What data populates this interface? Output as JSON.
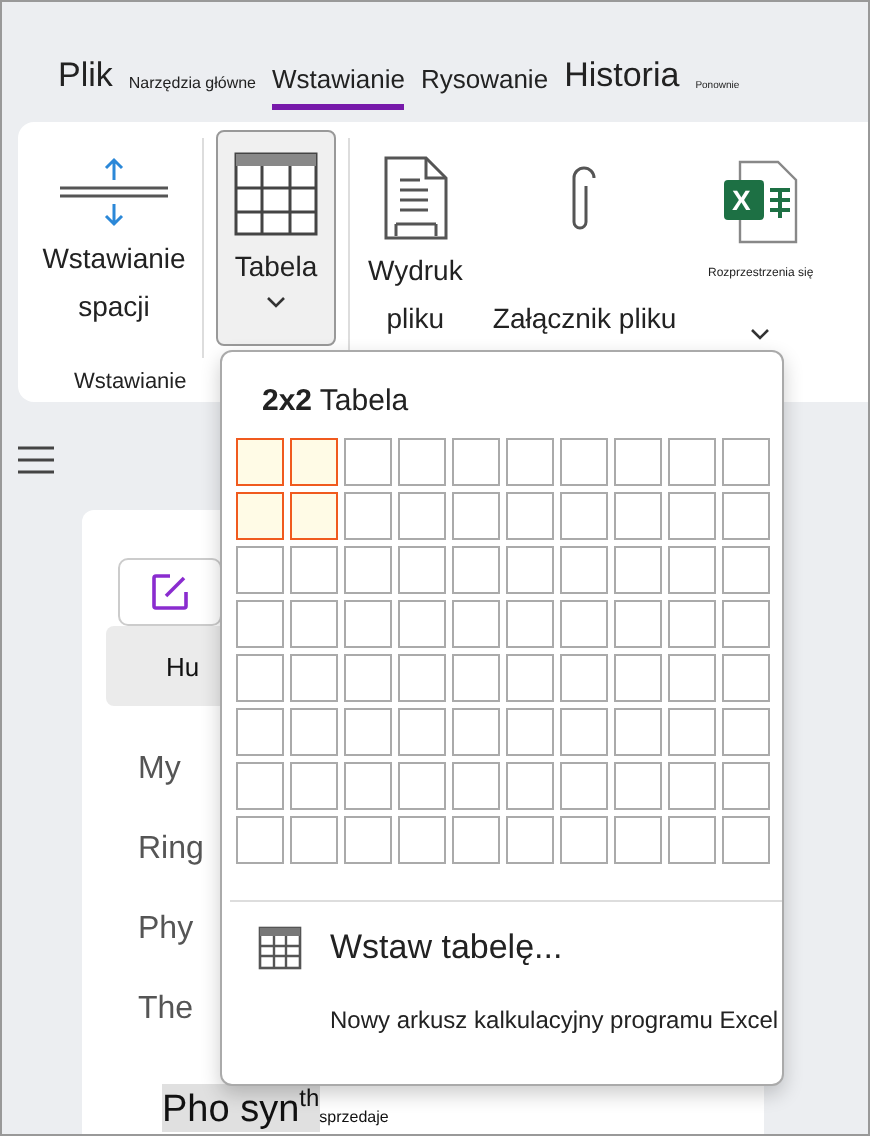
{
  "tabs": [
    {
      "label": "Plik",
      "selected": false
    },
    {
      "label": "Narzędzia główne",
      "selected": false
    },
    {
      "label": "Wstawianie",
      "selected": true
    },
    {
      "label": "Rysowanie",
      "selected": false
    },
    {
      "label": "Historia",
      "selected": false
    },
    {
      "label": "Ponownie",
      "selected": false
    }
  ],
  "ribbon": {
    "group_label": "Wstawianie",
    "buttons": [
      {
        "kind": "space",
        "lines": [
          "Wstawianie",
          "spacji"
        ],
        "selected": false
      },
      {
        "kind": "table",
        "lines": [
          "Tabela"
        ],
        "dropdown": true,
        "selected": true
      },
      {
        "kind": "printout",
        "lines": [
          "Wydruk",
          "pliku"
        ],
        "selected": false
      },
      {
        "kind": "attachment",
        "lines": [
          "Załącznik pliku"
        ],
        "selected": false
      },
      {
        "kind": "spreadsheet",
        "icon_letter": "X",
        "lines": [
          "Rozprzestrzenia się"
        ],
        "dropdown": true,
        "selected": false
      }
    ]
  },
  "notes": {
    "pages": [
      {
        "title": "Hu",
        "selected": true
      },
      {
        "title": "My",
        "selected": false
      },
      {
        "title": "Ring",
        "selected": false
      },
      {
        "title": "Phy",
        "selected": false
      },
      {
        "title": "The",
        "selected": false
      },
      {
        "title": "Pho syn$^{th}$",
        "suffix": "sprzedaje",
        "selected": true
      }
    ]
  },
  "table_menu": {
    "size": "2x2",
    "title": "Tabela",
    "grid": [
      {
        "cells": [
          {
            "selected": true
          },
          {
            "selected": true
          },
          {
            "selected": false
          },
          {
            "selected": false
          },
          {
            "selected": false
          },
          {
            "selected": false
          },
          {
            "selected": false
          },
          {
            "selected": false
          },
          {
            "selected": false
          },
          {
            "selected": false
          }
        ]
      },
      {
        "cells": [
          {
            "selected": true
          },
          {
            "selected": true
          },
          {
            "selected": false
          },
          {
            "selected": false
          },
          {
            "selected": false
          },
          {
            "selected": false
          },
          {
            "selected": false
          },
          {
            "selected": false
          },
          {
            "selected": false
          },
          {
            "selected": false
          }
        ]
      },
      {
        "cells": [
          {
            "selected": false
          },
          {
            "selected": false
          },
          {
            "selected": false
          },
          {
            "selected": false
          },
          {
            "selected": false
          },
          {
            "selected": false
          },
          {
            "selected": false
          },
          {
            "selected": false
          },
          {
            "selected": false
          },
          {
            "selected": false
          }
        ]
      },
      {
        "cells": [
          {
            "selected": false
          },
          {
            "selected": false
          },
          {
            "selected": false
          },
          {
            "selected": false
          },
          {
            "selected": false
          },
          {
            "selected": false
          },
          {
            "selected": false
          },
          {
            "selected": false
          },
          {
            "selected": false
          },
          {
            "selected": false
          }
        ]
      },
      {
        "cells": [
          {
            "selected": false
          },
          {
            "selected": false
          },
          {
            "selected": false
          },
          {
            "selected": false
          },
          {
            "selected": false
          },
          {
            "selected": false
          },
          {
            "selected": false
          },
          {
            "selected": false
          },
          {
            "selected": false
          },
          {
            "selected": false
          }
        ]
      },
      {
        "cells": [
          {
            "selected": false
          },
          {
            "selected": false
          },
          {
            "selected": false
          },
          {
            "selected": false
          },
          {
            "selected": false
          },
          {
            "selected": false
          },
          {
            "selected": false
          },
          {
            "selected": false
          },
          {
            "selected": false
          },
          {
            "selected": false
          }
        ]
      },
      {
        "cells": [
          {
            "selected": false
          },
          {
            "selected": false
          },
          {
            "selected": false
          },
          {
            "selected": false
          },
          {
            "selected": false
          },
          {
            "selected": false
          },
          {
            "selected": false
          },
          {
            "selected": false
          },
          {
            "selected": false
          },
          {
            "selected": false
          }
        ]
      },
      {
        "cells": [
          {
            "selected": false
          },
          {
            "selected": false
          },
          {
            "selected": false
          },
          {
            "selected": false
          },
          {
            "selected": false
          },
          {
            "selected": false
          },
          {
            "selected": false
          },
          {
            "selected": false
          },
          {
            "selected": false
          },
          {
            "selected": false
          }
        ]
      }
    ],
    "items": [
      {
        "kind": "insert",
        "label": "Wstaw tabelę..."
      },
      {
        "kind": "excel",
        "label": "Nowy arkusz kalkulacyjny programu Excel"
      }
    ]
  }
}
